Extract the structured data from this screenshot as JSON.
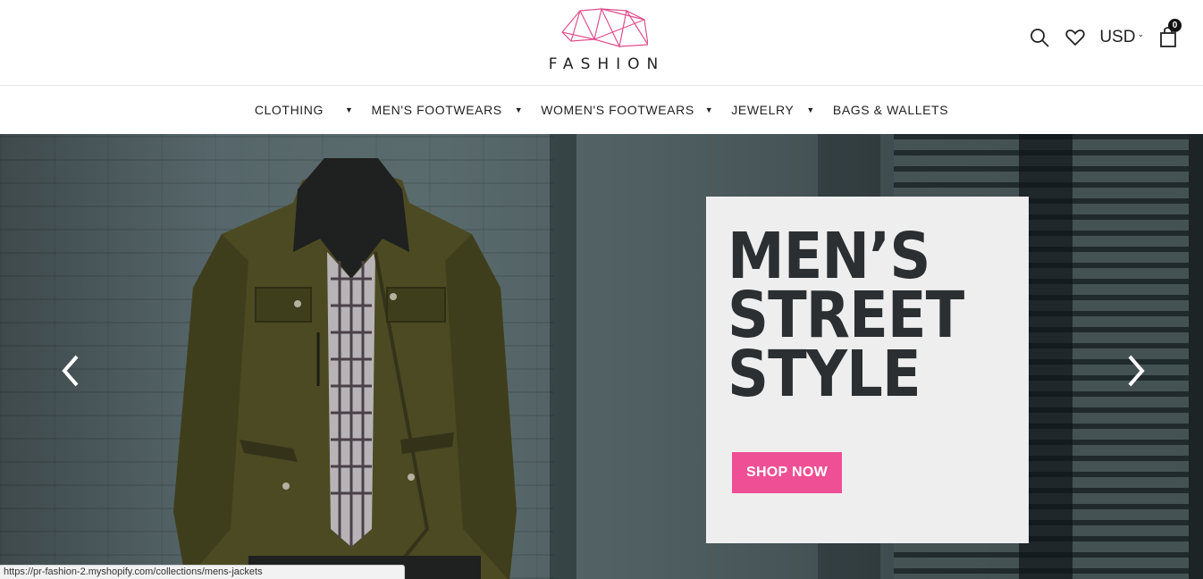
{
  "header": {
    "logo_text": "FASHION",
    "icons": [
      "search-icon",
      "heart-icon",
      "cart-icon"
    ],
    "currency": "USD",
    "cart_count": "0"
  },
  "nav": {
    "items": [
      {
        "label": "CLOTHING",
        "has_dropdown": true
      },
      {
        "label": "MEN'S FOOTWEARS",
        "has_dropdown": true
      },
      {
        "label": "WOMEN'S FOOTWEARS",
        "has_dropdown": true
      },
      {
        "label": "JEWELRY",
        "has_dropdown": true
      },
      {
        "label": "BAGS & WALLETS",
        "has_dropdown": false
      }
    ]
  },
  "hero": {
    "title_lines": [
      "MEN’S",
      "STREET",
      "STYLE"
    ],
    "cta_label": "SHOP NOW",
    "prev_icon": "chevron-left-icon",
    "next_icon": "chevron-right-icon"
  },
  "status_bar": {
    "url": "https://pr-fashion-2.myshopify.com/collections/mens-jackets"
  },
  "colors": {
    "accent": "#ef4f94",
    "logo_pink": "#e0508e",
    "text": "#222222"
  }
}
